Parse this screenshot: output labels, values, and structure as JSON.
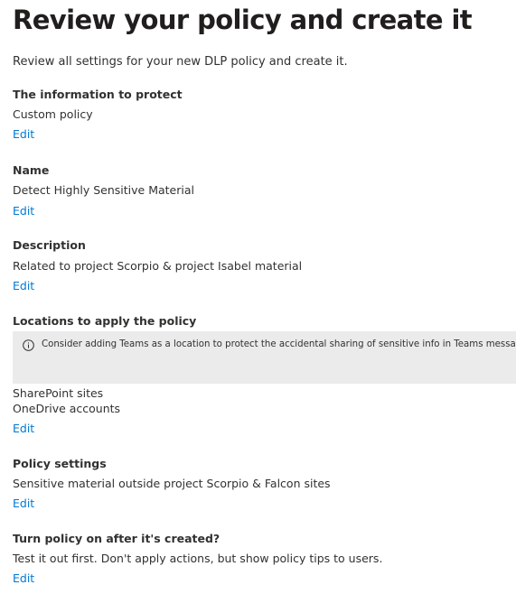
{
  "page": {
    "title": "Review your policy and create it",
    "subtitle": "Review all settings for your new DLP policy and create it."
  },
  "sections": {
    "info": {
      "heading": "The information to protect",
      "value": "Custom policy",
      "edit": "Edit"
    },
    "name": {
      "heading": "Name",
      "value": "Detect Highly Sensitive Material",
      "edit": "Edit"
    },
    "description": {
      "heading": "Description",
      "value": "Related to project Scorpio & project Isabel material",
      "edit": "Edit"
    },
    "locations": {
      "heading": "Locations to apply the policy",
      "notice": "Consider adding Teams as a location to protect the accidental sharing of sensitive info in Teams messages.",
      "notice_icon": "info-icon",
      "items": [
        "SharePoint sites",
        "OneDrive accounts"
      ],
      "edit": "Edit"
    },
    "policy_settings": {
      "heading": "Policy settings",
      "value": "Sensitive material outside project Scorpio & Falcon sites",
      "edit": "Edit"
    },
    "turn_on": {
      "heading": "Turn policy on after it's created?",
      "value": "Test it out first. Don't apply actions, but show policy tips to users.",
      "edit": "Edit"
    }
  },
  "colors": {
    "link": "#0078d4",
    "text": "#323130",
    "notice_background": "#ebebeb"
  }
}
